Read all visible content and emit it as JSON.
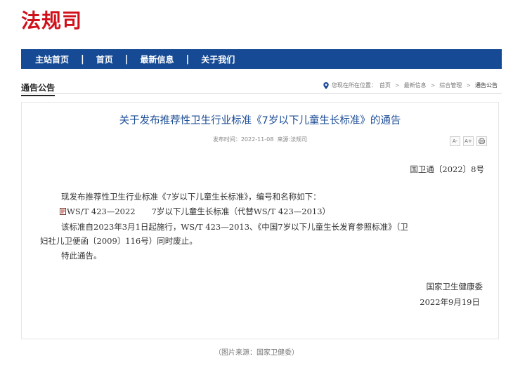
{
  "site": {
    "logo": "法规司"
  },
  "nav": {
    "items": [
      "主站首页",
      "首页",
      "最新信息",
      "关于我们"
    ],
    "separator": "|"
  },
  "section": {
    "title": "通告公告"
  },
  "breadcrumb": {
    "prefix": "您现在所在位置：",
    "items": [
      "首页",
      "最新信息",
      "综合管理",
      "通告公告"
    ],
    "separator": ">"
  },
  "article": {
    "title": "关于发布推荐性卫生行业标准《7岁以下儿童生长标准》的通告",
    "publish_label": "发布时间：",
    "publish_date": "2022-11-08",
    "source_label": "来源:",
    "source": "法规司",
    "tools": {
      "font_smaller": "A-",
      "font_larger": "A+",
      "print": "print-icon"
    },
    "doc_number": "国卫通〔2022〕8号",
    "paragraph1": "现发布推荐性卫生行业标准《7岁以下儿童生长标准》，编号和名称如下：",
    "standard_line": "WS/T 423—2022　　7岁以下儿童生长标准（代替WS/T 423—2013）",
    "paragraph3": "该标准自2023年3月1日起施行，WS/T 423—2013、《中国7岁以下儿童生长发育参照标准》（卫",
    "paragraph4": "妇社儿卫便函〔2009〕116号）同时废止。",
    "paragraph5": "特此通告。",
    "signatory": "国家卫生健康委",
    "sign_date": "2022年9月19日"
  },
  "caption": "（图片来源：国家卫健委）",
  "colors": {
    "logo": "#d0101b",
    "nav_bg": "#164a94",
    "title": "#1d4d96"
  }
}
